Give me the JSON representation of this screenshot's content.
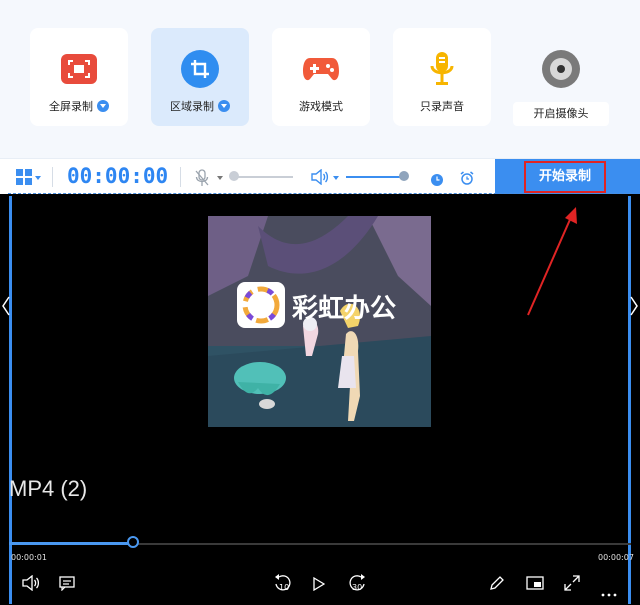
{
  "modes": [
    {
      "label": "全屏录制",
      "icon": "fullscreen-record-icon",
      "dropdown": true
    },
    {
      "label": "区域录制",
      "icon": "region-record-icon",
      "dropdown": true,
      "active": true
    },
    {
      "label": "游戏模式",
      "icon": "gamepad-icon",
      "dropdown": false
    },
    {
      "label": "只录声音",
      "icon": "microphone-icon",
      "dropdown": false
    }
  ],
  "camera": {
    "label": "开启摄像头",
    "icon": "webcam-icon"
  },
  "toolbar": {
    "timer": "00:00:00",
    "mic_level": 0.0,
    "volume_level": 1.0,
    "start_label": "开始录制"
  },
  "player": {
    "title": "MP4 (2)",
    "watermark": "彩虹办公",
    "time_current": "00:00:01",
    "time_total": "00:00:07",
    "progress": 0.2,
    "skip_back": "10",
    "skip_forward": "30"
  },
  "colors": {
    "accent": "#3b8ef0",
    "highlight_border": "#e02424",
    "active_mode_bg": "#dbeafc",
    "player_bg": "#000000"
  }
}
